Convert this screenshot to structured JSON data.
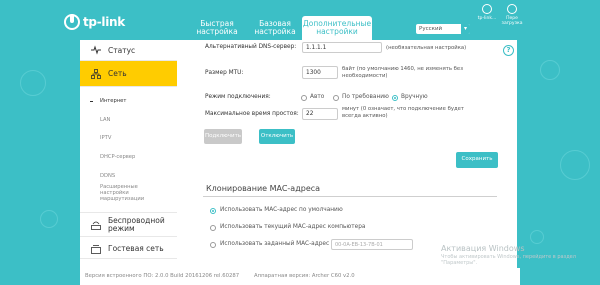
{
  "header": {
    "logo_text": "tp-link",
    "tabs": [
      {
        "label": "Быстрая настройка",
        "active": false
      },
      {
        "label": "Базовая настройка",
        "active": false
      },
      {
        "label": "Дополнительные настройки",
        "active": true
      }
    ],
    "language": "Русский",
    "icons": [
      {
        "name": "tp-link-cloud-icon",
        "label": "tp-link..."
      },
      {
        "name": "reboot-icon",
        "label": "Пере загрузка"
      }
    ]
  },
  "nav": {
    "items": [
      {
        "label": "Статус",
        "icon": "pulse-icon",
        "active": false
      },
      {
        "label": "Сеть",
        "icon": "network-icon",
        "active": true
      },
      {
        "label": "Беспроводной режим",
        "icon": "wireless-icon",
        "active": false
      },
      {
        "label": "Гостевая сеть",
        "icon": "guest-network-icon",
        "active": false
      }
    ],
    "sub_items": [
      {
        "label": "Интернет",
        "current": true
      },
      {
        "label": "LAN",
        "current": false
      },
      {
        "label": "IPTV",
        "current": false
      },
      {
        "label": "DHCP-сервер",
        "current": false
      },
      {
        "label": "DDNS",
        "current": false
      },
      {
        "label": "Расширенные настройки маршрутизации",
        "current": false
      }
    ]
  },
  "form": {
    "alt_dns_label": "Альтернативный DNS-сервер:",
    "alt_dns_value": "1.1.1.1",
    "alt_dns_note": "(необязательная настройка)",
    "mtu_label": "Размер MTU:",
    "mtu_value": "1300",
    "mtu_note": "байт (по умолчанию 1460, не изменять без необходимости)",
    "conn_mode_label": "Режим подключения:",
    "conn_modes": [
      {
        "label": "Авто",
        "selected": false
      },
      {
        "label": "По требованию",
        "selected": false
      },
      {
        "label": "Вручную",
        "selected": true
      }
    ],
    "idle_label": "Максимальное время простоя:",
    "idle_value": "22",
    "idle_note": "минут (0 означает, что подключение будет всегда активно)",
    "connect_label": "Подключить",
    "disconnect_label": "Отключить",
    "save_label": "Сохранить"
  },
  "mac_clone": {
    "title": "Клонирование MAC-адреса",
    "options": [
      {
        "label": "Использовать MAC-адрес по умолчанию",
        "selected": true
      },
      {
        "label": "Использовать текущий MAC-адрес компьютера",
        "selected": false
      },
      {
        "label": "Использовать заданный MAC-адрес",
        "selected": false
      }
    ],
    "mac_placeholder": "00-0A-EB-13-7B-01"
  },
  "footer": {
    "firmware": "Версия встроенного ПО: 2.0.0 Build 20161206 rel.60287",
    "hardware": "Аппаратная версия: Archer C60 v2.0"
  },
  "watermark": {
    "title": "Активация Windows",
    "text": "Чтобы активировать Windows, перейдите в раздел \"Параметры\"."
  },
  "colors": {
    "accent": "#3cbfc6",
    "active_nav": "#ffcc00",
    "background": "#3cbfc6"
  }
}
